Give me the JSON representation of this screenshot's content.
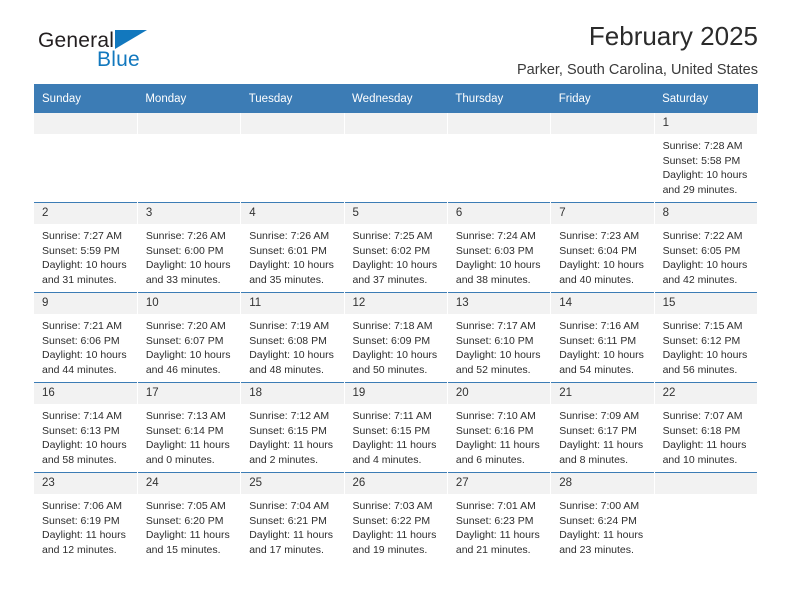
{
  "brand": {
    "name_top": "General",
    "name_bottom": "Blue",
    "accent_color": "#1278be"
  },
  "header": {
    "title": "February 2025",
    "subtitle": "Parker, South Carolina, United States"
  },
  "theme": {
    "header_blue": "#3c7cb5",
    "daynum_band": "#f2f2f2",
    "text": "#2d2d2d"
  },
  "calendar": {
    "weekday_headers": [
      "Sunday",
      "Monday",
      "Tuesday",
      "Wednesday",
      "Thursday",
      "Friday",
      "Saturday"
    ],
    "labels": {
      "sunrise": "Sunrise:",
      "sunset": "Sunset:",
      "daylight": "Daylight:"
    },
    "weeks": [
      [
        {
          "day": "",
          "empty": true,
          "sunrise": "",
          "sunset": "",
          "daylight_line1": "",
          "daylight_line2": ""
        },
        {
          "day": "",
          "empty": true,
          "sunrise": "",
          "sunset": "",
          "daylight_line1": "",
          "daylight_line2": ""
        },
        {
          "day": "",
          "empty": true,
          "sunrise": "",
          "sunset": "",
          "daylight_line1": "",
          "daylight_line2": ""
        },
        {
          "day": "",
          "empty": true,
          "sunrise": "",
          "sunset": "",
          "daylight_line1": "",
          "daylight_line2": ""
        },
        {
          "day": "",
          "empty": true,
          "sunrise": "",
          "sunset": "",
          "daylight_line1": "",
          "daylight_line2": ""
        },
        {
          "day": "",
          "empty": true,
          "sunrise": "",
          "sunset": "",
          "daylight_line1": "",
          "daylight_line2": ""
        },
        {
          "day": "1",
          "empty": false,
          "sunrise": "Sunrise: 7:28 AM",
          "sunset": "Sunset: 5:58 PM",
          "daylight_line1": "Daylight: 10 hours",
          "daylight_line2": "and 29 minutes."
        }
      ],
      [
        {
          "day": "2",
          "empty": false,
          "sunrise": "Sunrise: 7:27 AM",
          "sunset": "Sunset: 5:59 PM",
          "daylight_line1": "Daylight: 10 hours",
          "daylight_line2": "and 31 minutes."
        },
        {
          "day": "3",
          "empty": false,
          "sunrise": "Sunrise: 7:26 AM",
          "sunset": "Sunset: 6:00 PM",
          "daylight_line1": "Daylight: 10 hours",
          "daylight_line2": "and 33 minutes."
        },
        {
          "day": "4",
          "empty": false,
          "sunrise": "Sunrise: 7:26 AM",
          "sunset": "Sunset: 6:01 PM",
          "daylight_line1": "Daylight: 10 hours",
          "daylight_line2": "and 35 minutes."
        },
        {
          "day": "5",
          "empty": false,
          "sunrise": "Sunrise: 7:25 AM",
          "sunset": "Sunset: 6:02 PM",
          "daylight_line1": "Daylight: 10 hours",
          "daylight_line2": "and 37 minutes."
        },
        {
          "day": "6",
          "empty": false,
          "sunrise": "Sunrise: 7:24 AM",
          "sunset": "Sunset: 6:03 PM",
          "daylight_line1": "Daylight: 10 hours",
          "daylight_line2": "and 38 minutes."
        },
        {
          "day": "7",
          "empty": false,
          "sunrise": "Sunrise: 7:23 AM",
          "sunset": "Sunset: 6:04 PM",
          "daylight_line1": "Daylight: 10 hours",
          "daylight_line2": "and 40 minutes."
        },
        {
          "day": "8",
          "empty": false,
          "sunrise": "Sunrise: 7:22 AM",
          "sunset": "Sunset: 6:05 PM",
          "daylight_line1": "Daylight: 10 hours",
          "daylight_line2": "and 42 minutes."
        }
      ],
      [
        {
          "day": "9",
          "empty": false,
          "sunrise": "Sunrise: 7:21 AM",
          "sunset": "Sunset: 6:06 PM",
          "daylight_line1": "Daylight: 10 hours",
          "daylight_line2": "and 44 minutes."
        },
        {
          "day": "10",
          "empty": false,
          "sunrise": "Sunrise: 7:20 AM",
          "sunset": "Sunset: 6:07 PM",
          "daylight_line1": "Daylight: 10 hours",
          "daylight_line2": "and 46 minutes."
        },
        {
          "day": "11",
          "empty": false,
          "sunrise": "Sunrise: 7:19 AM",
          "sunset": "Sunset: 6:08 PM",
          "daylight_line1": "Daylight: 10 hours",
          "daylight_line2": "and 48 minutes."
        },
        {
          "day": "12",
          "empty": false,
          "sunrise": "Sunrise: 7:18 AM",
          "sunset": "Sunset: 6:09 PM",
          "daylight_line1": "Daylight: 10 hours",
          "daylight_line2": "and 50 minutes."
        },
        {
          "day": "13",
          "empty": false,
          "sunrise": "Sunrise: 7:17 AM",
          "sunset": "Sunset: 6:10 PM",
          "daylight_line1": "Daylight: 10 hours",
          "daylight_line2": "and 52 minutes."
        },
        {
          "day": "14",
          "empty": false,
          "sunrise": "Sunrise: 7:16 AM",
          "sunset": "Sunset: 6:11 PM",
          "daylight_line1": "Daylight: 10 hours",
          "daylight_line2": "and 54 minutes."
        },
        {
          "day": "15",
          "empty": false,
          "sunrise": "Sunrise: 7:15 AM",
          "sunset": "Sunset: 6:12 PM",
          "daylight_line1": "Daylight: 10 hours",
          "daylight_line2": "and 56 minutes."
        }
      ],
      [
        {
          "day": "16",
          "empty": false,
          "sunrise": "Sunrise: 7:14 AM",
          "sunset": "Sunset: 6:13 PM",
          "daylight_line1": "Daylight: 10 hours",
          "daylight_line2": "and 58 minutes."
        },
        {
          "day": "17",
          "empty": false,
          "sunrise": "Sunrise: 7:13 AM",
          "sunset": "Sunset: 6:14 PM",
          "daylight_line1": "Daylight: 11 hours",
          "daylight_line2": "and 0 minutes."
        },
        {
          "day": "18",
          "empty": false,
          "sunrise": "Sunrise: 7:12 AM",
          "sunset": "Sunset: 6:15 PM",
          "daylight_line1": "Daylight: 11 hours",
          "daylight_line2": "and 2 minutes."
        },
        {
          "day": "19",
          "empty": false,
          "sunrise": "Sunrise: 7:11 AM",
          "sunset": "Sunset: 6:15 PM",
          "daylight_line1": "Daylight: 11 hours",
          "daylight_line2": "and 4 minutes."
        },
        {
          "day": "20",
          "empty": false,
          "sunrise": "Sunrise: 7:10 AM",
          "sunset": "Sunset: 6:16 PM",
          "daylight_line1": "Daylight: 11 hours",
          "daylight_line2": "and 6 minutes."
        },
        {
          "day": "21",
          "empty": false,
          "sunrise": "Sunrise: 7:09 AM",
          "sunset": "Sunset: 6:17 PM",
          "daylight_line1": "Daylight: 11 hours",
          "daylight_line2": "and 8 minutes."
        },
        {
          "day": "22",
          "empty": false,
          "sunrise": "Sunrise: 7:07 AM",
          "sunset": "Sunset: 6:18 PM",
          "daylight_line1": "Daylight: 11 hours",
          "daylight_line2": "and 10 minutes."
        }
      ],
      [
        {
          "day": "23",
          "empty": false,
          "sunrise": "Sunrise: 7:06 AM",
          "sunset": "Sunset: 6:19 PM",
          "daylight_line1": "Daylight: 11 hours",
          "daylight_line2": "and 12 minutes."
        },
        {
          "day": "24",
          "empty": false,
          "sunrise": "Sunrise: 7:05 AM",
          "sunset": "Sunset: 6:20 PM",
          "daylight_line1": "Daylight: 11 hours",
          "daylight_line2": "and 15 minutes."
        },
        {
          "day": "25",
          "empty": false,
          "sunrise": "Sunrise: 7:04 AM",
          "sunset": "Sunset: 6:21 PM",
          "daylight_line1": "Daylight: 11 hours",
          "daylight_line2": "and 17 minutes."
        },
        {
          "day": "26",
          "empty": false,
          "sunrise": "Sunrise: 7:03 AM",
          "sunset": "Sunset: 6:22 PM",
          "daylight_line1": "Daylight: 11 hours",
          "daylight_line2": "and 19 minutes."
        },
        {
          "day": "27",
          "empty": false,
          "sunrise": "Sunrise: 7:01 AM",
          "sunset": "Sunset: 6:23 PM",
          "daylight_line1": "Daylight: 11 hours",
          "daylight_line2": "and 21 minutes."
        },
        {
          "day": "28",
          "empty": false,
          "sunrise": "Sunrise: 7:00 AM",
          "sunset": "Sunset: 6:24 PM",
          "daylight_line1": "Daylight: 11 hours",
          "daylight_line2": "and 23 minutes."
        },
        {
          "day": "",
          "empty": true,
          "sunrise": "",
          "sunset": "",
          "daylight_line1": "",
          "daylight_line2": ""
        }
      ]
    ]
  }
}
